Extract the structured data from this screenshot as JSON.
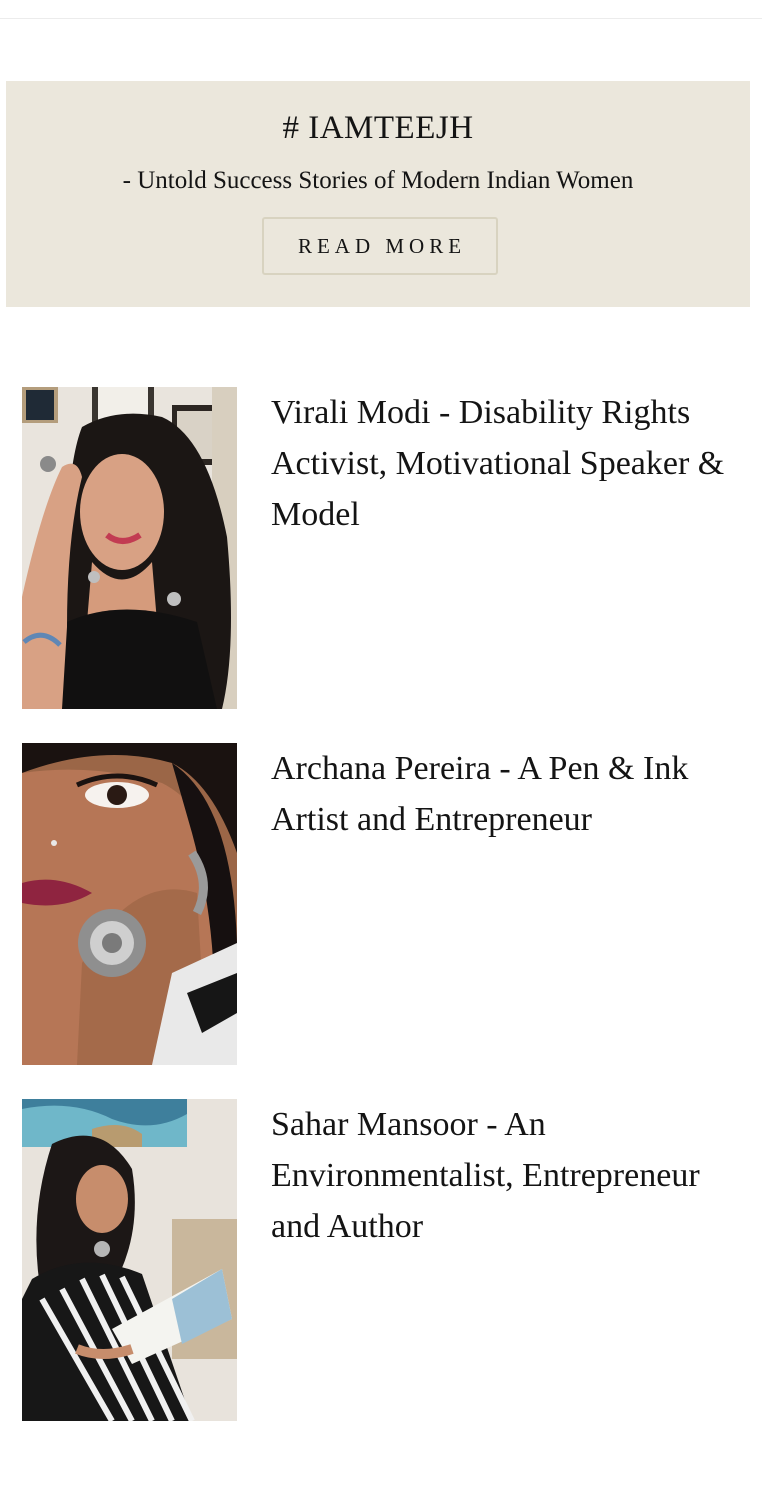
{
  "banner": {
    "title": "# IAMTEEJH",
    "subtitle": "- Untold Success Stories of Modern Indian Women",
    "button_label": "READ MORE",
    "background_color": "#ebe7dc"
  },
  "stories": [
    {
      "title": "Virali Modi - Disability Rights Activist, Motivational Speaker & Model",
      "image_icon": "portrait-photo-smiling-woman"
    },
    {
      "title": "Archana Pereira - A Pen & Ink Artist and Entrepreneur",
      "image_icon": "portrait-photo-woman-with-ring"
    },
    {
      "title": "Sahar Mansoor - An Environmentalist, Entrepreneur and Author",
      "image_icon": "portrait-photo-woman-reading"
    }
  ]
}
